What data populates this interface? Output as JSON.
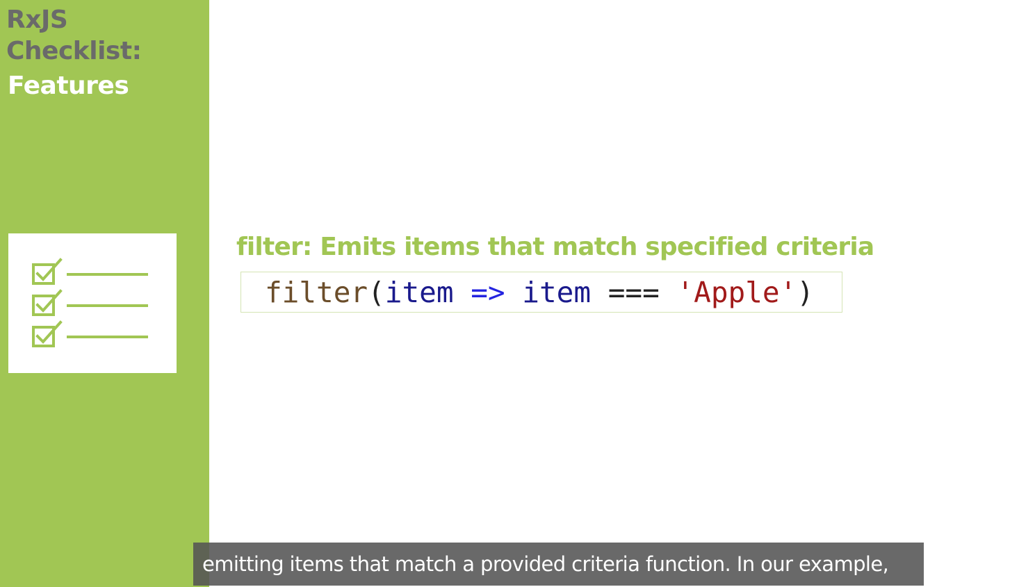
{
  "sidebar": {
    "title_line1": "RxJS",
    "title_line2": "Checklist:",
    "title_line3": "Features",
    "illustration": "checklist-icon"
  },
  "main": {
    "heading": {
      "keyword": "filter",
      "rest": ": Emits items that match specified criteria"
    },
    "code": {
      "fn": "filter",
      "open_paren": "(",
      "param": "item",
      "arrow": " => ",
      "param2": "item",
      "equals": " === ",
      "string": "'Apple'",
      "close_paren": ")"
    }
  },
  "caption": {
    "text": "emitting items that match a provided criteria function. In our example,"
  },
  "colors": {
    "accent": "#a1c654",
    "title_gray": "#6a6a6a",
    "code_fn": "#6b4d2a",
    "code_param": "#1a1a8c",
    "code_operator": "#2424e0",
    "code_string": "#a11a1a",
    "caption_bg": "#545454"
  }
}
